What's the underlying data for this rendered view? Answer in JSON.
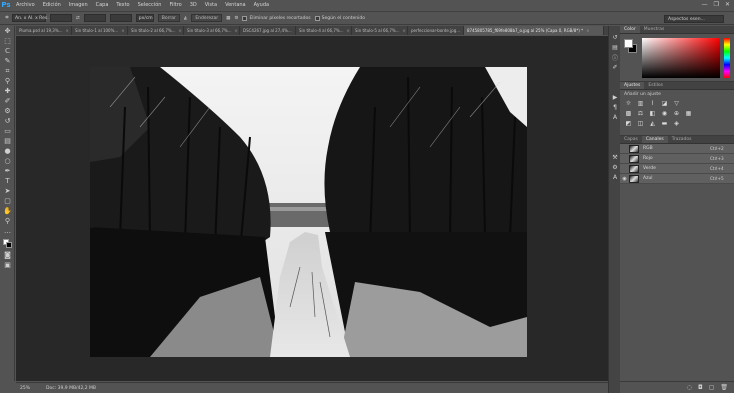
{
  "app": {
    "logo": "Ps"
  },
  "menu": [
    "Archivo",
    "Edición",
    "Imagen",
    "Capa",
    "Texto",
    "Selección",
    "Filtro",
    "3D",
    "Vista",
    "Ventana",
    "Ayuda"
  ],
  "window_controls": [
    "—",
    "❐",
    "✕"
  ],
  "options_bar": {
    "tool_preset": "An. x Al. x Res.",
    "width_value": "",
    "height_value": "",
    "resolution_unit": "px/cm",
    "clear_button": "Borrar",
    "straighten_button": "Enderezar",
    "delete_cropped_label": "Eliminar píxeles recortados",
    "content_aware_label": "Según el contenido",
    "search_placeholder": "Aspectos esen..."
  },
  "doc_tabs": [
    {
      "label": "Pluma.psd al 19,3%...",
      "active": false
    },
    {
      "label": "Sin título-1 al 100%...",
      "active": false
    },
    {
      "label": "Sin título-2 al 66,7%...",
      "active": false
    },
    {
      "label": "Sin título-3 al 66,7%...",
      "active": false
    },
    {
      "label": "DSC4267.jpg al 27,4%...",
      "active": false
    },
    {
      "label": "Sin título-4 al 66,7%...",
      "active": false
    },
    {
      "label": "Sin título-5 al 66,7%...",
      "active": false
    },
    {
      "label": "perfeccionar-borde.jpg...",
      "active": false
    },
    {
      "label": "8745805785_f69fe808b7_o.jpg al 25% (Capa 0, RGB/8*) *",
      "active": true
    }
  ],
  "tools": [
    "move-icon",
    "marquee-icon",
    "lasso-icon",
    "quick-select-icon",
    "crop-icon",
    "eyedropper-icon",
    "healing-icon",
    "brush-icon",
    "stamp-icon",
    "history-brush-icon",
    "eraser-icon",
    "gradient-icon",
    "blur-icon",
    "dodge-icon",
    "pen-icon",
    "type-icon",
    "path-select-icon",
    "shape-icon",
    "hand-icon",
    "zoom-icon"
  ],
  "status": {
    "zoom": "25%",
    "doc_info": "Doc: 39,9 MB/42,2 MB"
  },
  "panels": {
    "color_tabs": [
      "Color",
      "Muestras"
    ],
    "adjust_tabs": [
      "Ajustes",
      "Estilos"
    ],
    "adjust_title": "Añadir un ajuste",
    "channel_tabs": [
      "Capas",
      "Canales",
      "Trazados"
    ],
    "channels": [
      {
        "name": "RGB",
        "shortcut": "Ctrl+2"
      },
      {
        "name": "Rojo",
        "shortcut": "Ctrl+3"
      },
      {
        "name": "Verde",
        "shortcut": "Ctrl+4"
      },
      {
        "name": "Azul",
        "shortcut": "Ctrl+5"
      }
    ]
  },
  "colors": {
    "accent": "#31a8ff",
    "panel_bg": "#535353",
    "canvas_bg": "#282828"
  }
}
